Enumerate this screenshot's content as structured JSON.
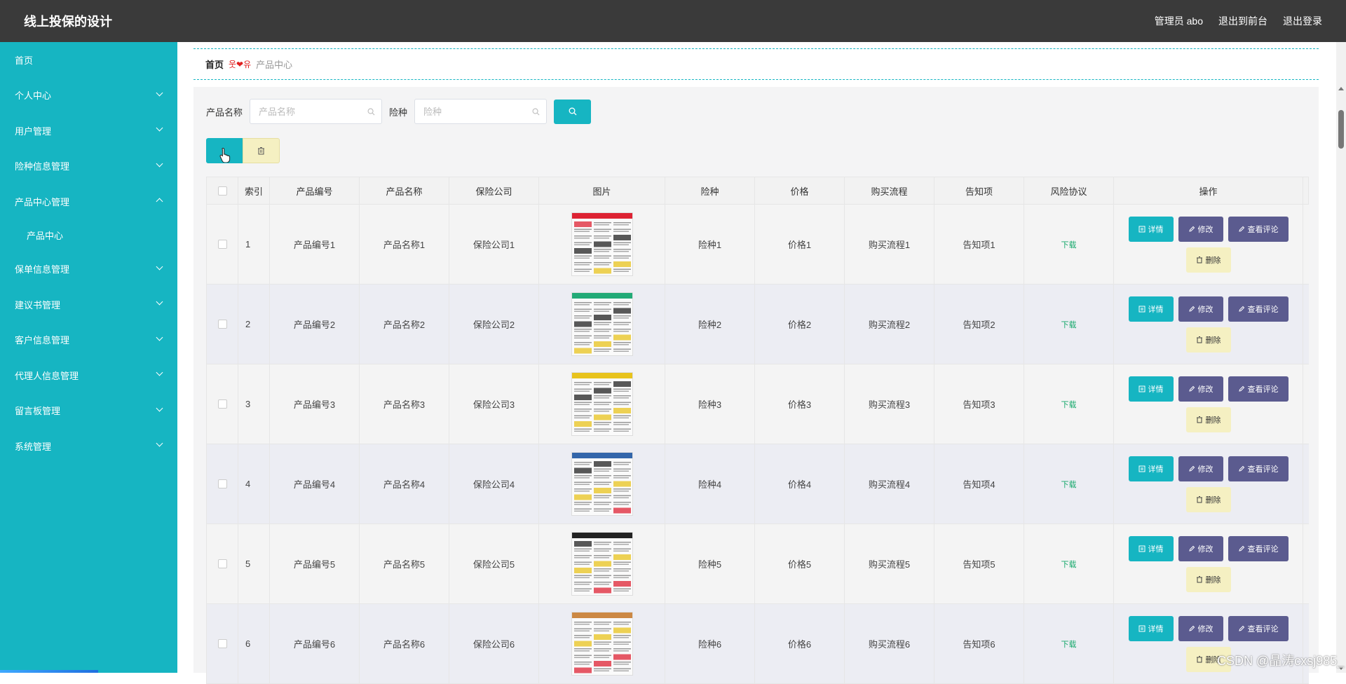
{
  "app": {
    "title": "线上投保的设计"
  },
  "topbar": {
    "user": "管理员 abo",
    "front_link": "退出到前台",
    "logout": "退出登录"
  },
  "sidebar": {
    "items": [
      {
        "label": "首页",
        "type": "link"
      },
      {
        "label": "个人中心",
        "type": "group"
      },
      {
        "label": "用户管理",
        "type": "group"
      },
      {
        "label": "险种信息管理",
        "type": "group"
      },
      {
        "label": "产品中心管理",
        "type": "group-open"
      },
      {
        "label": "产品中心",
        "type": "sub"
      },
      {
        "label": "保单信息管理",
        "type": "group"
      },
      {
        "label": "建议书管理",
        "type": "group"
      },
      {
        "label": "客户信息管理",
        "type": "group"
      },
      {
        "label": "代理人信息管理",
        "type": "group"
      },
      {
        "label": "留言板管理",
        "type": "group"
      },
      {
        "label": "系统管理",
        "type": "group"
      }
    ]
  },
  "breadcrumb": {
    "home": "首页",
    "separator": "웃❤유",
    "current": "产品中心"
  },
  "search": {
    "name_label": "产品名称",
    "name_placeholder": "产品名称",
    "type_label": "险种",
    "type_placeholder": "险种"
  },
  "table": {
    "headers": [
      "索引",
      "产品编号",
      "产品名称",
      "保险公司",
      "图片",
      "险种",
      "价格",
      "购买流程",
      "告知项",
      "风险协议",
      "操作"
    ],
    "rows": [
      {
        "index": "1",
        "code": "产品编号1",
        "name": "产品名称1",
        "company": "保险公司1",
        "image": "newspaper-thumbnail",
        "type": "险种1",
        "price": "价格1",
        "process": "购买流程1",
        "notice": "告知项1",
        "risk": "下载"
      },
      {
        "index": "2",
        "code": "产品编号2",
        "name": "产品名称2",
        "company": "保险公司2",
        "image": "newspaper-thumbnail",
        "type": "险种2",
        "price": "价格2",
        "process": "购买流程2",
        "notice": "告知项2",
        "risk": "下载"
      },
      {
        "index": "3",
        "code": "产品编号3",
        "name": "产品名称3",
        "company": "保险公司3",
        "image": "newspaper-thumbnail",
        "type": "险种3",
        "price": "价格3",
        "process": "购买流程3",
        "notice": "告知项3",
        "risk": "下载"
      },
      {
        "index": "4",
        "code": "产品编号4",
        "name": "产品名称4",
        "company": "保险公司4",
        "image": "newspaper-thumbnail",
        "type": "险种4",
        "price": "价格4",
        "process": "购买流程4",
        "notice": "告知项4",
        "risk": "下载"
      },
      {
        "index": "5",
        "code": "产品编号5",
        "name": "产品名称5",
        "company": "保险公司5",
        "image": "newspaper-thumbnail",
        "type": "险种5",
        "price": "价格5",
        "process": "购买流程5",
        "notice": "告知项5",
        "risk": "下载"
      },
      {
        "index": "6",
        "code": "产品编号6",
        "name": "产品名称6",
        "company": "保险公司6",
        "image": "newspaper-thumbnail",
        "type": "险种6",
        "price": "价格6",
        "process": "购买流程6",
        "notice": "告知项6",
        "risk": "下载"
      }
    ],
    "actions": {
      "detail": "详情",
      "edit": "修改",
      "comment": "查看评论",
      "delete": "删除"
    }
  },
  "watermark": "CSDN @晶涛cxsj985_",
  "colors": {
    "accent": "#16b5c2",
    "topbar": "#3a3a3a",
    "secondary": "#5b5b8f",
    "warning_bg": "#f5f0c2",
    "download": "#16a86b"
  }
}
